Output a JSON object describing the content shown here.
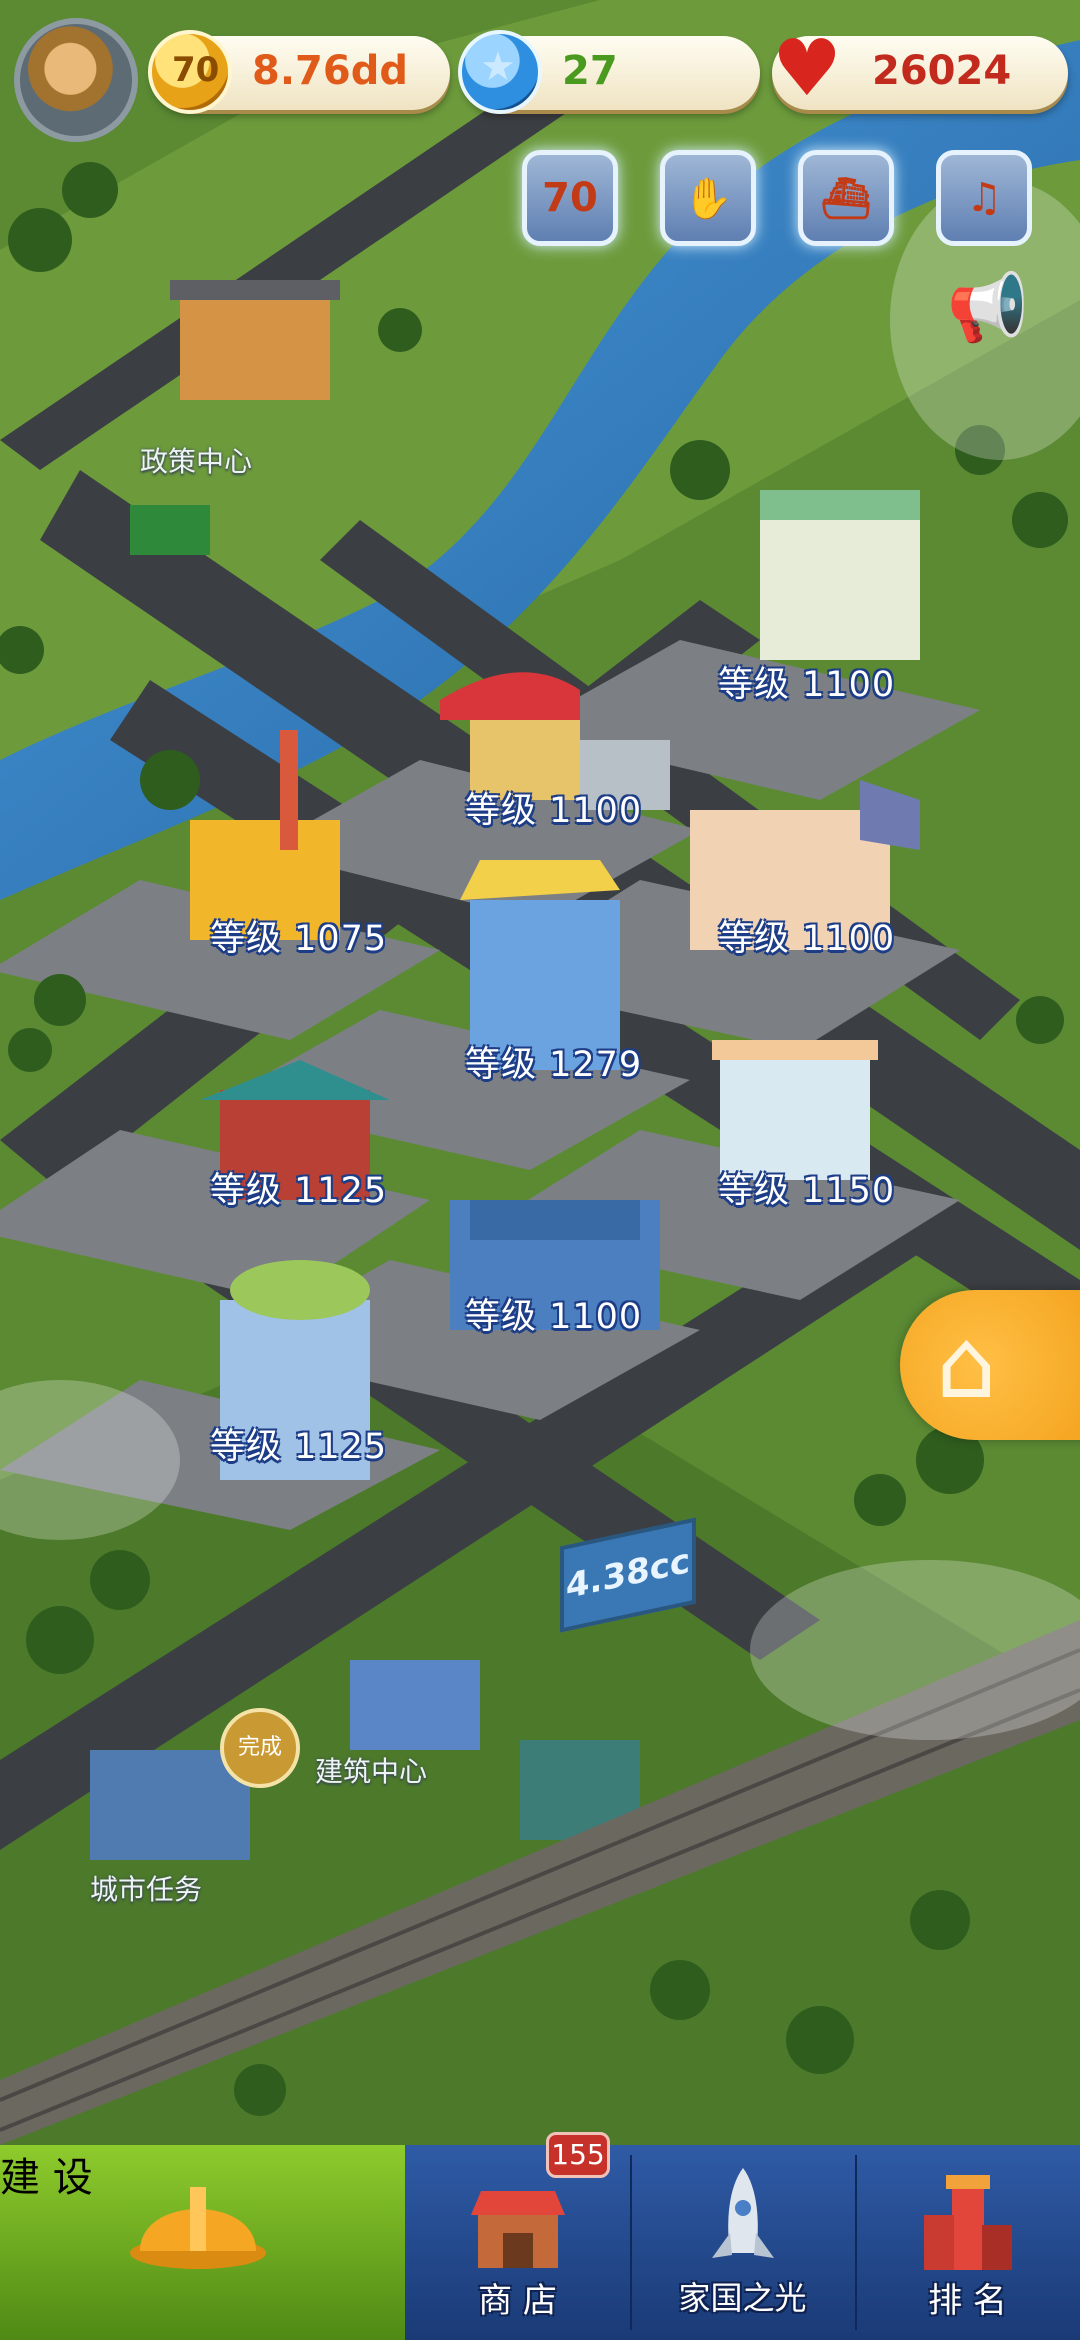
{
  "resources": {
    "coin_icon": "70",
    "coins": "8.76dd",
    "gems": "27",
    "hearts": "26024",
    "coin_color": "#e05a1a",
    "gem_color": "#4a9a1f",
    "heart_color": "#c22a1e"
  },
  "event_buttons": [
    {
      "icon": "70-anniversary-icon",
      "glyph": "70"
    },
    {
      "icon": "handshake-icon",
      "glyph": "✋"
    },
    {
      "icon": "ship-icon",
      "glyph": "⛴"
    },
    {
      "icon": "celebration-icon",
      "glyph": "♫"
    }
  ],
  "places": {
    "policy_center": "政策中心",
    "build_center": "建筑中心",
    "city_tasks": "城市任务",
    "done": "完成",
    "billboard": "4.38cc"
  },
  "buildings": [
    {
      "name": "safety-factory",
      "level": "等级 1100"
    },
    {
      "name": "textile-factory",
      "level": "等级 1100"
    },
    {
      "name": "power-plant",
      "level": "等级 1075"
    },
    {
      "name": "office-building",
      "level": "等级 1100"
    },
    {
      "name": "library",
      "level": "等级 1279"
    },
    {
      "name": "temple",
      "level": "等级 1125"
    },
    {
      "name": "house",
      "level": "等级 1150"
    },
    {
      "name": "restaurant",
      "level": "等级 1100"
    },
    {
      "name": "hotel",
      "level": "等级 1125"
    }
  ],
  "nav": {
    "build": "建 设",
    "shop": "商 店",
    "shop_badge": "155",
    "glory": "家国之光",
    "rank": "排 名"
  }
}
